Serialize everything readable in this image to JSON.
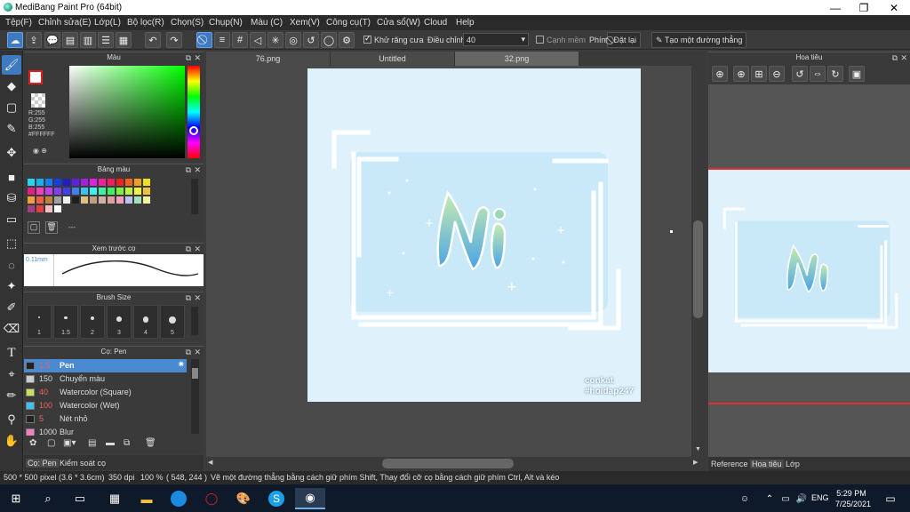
{
  "window": {
    "title": "MediBang Paint Pro (64bit)",
    "minimize": "—",
    "maximize": "❐",
    "close": "✕"
  },
  "menu": [
    "Tệp(F)",
    "Chỉnh sửa(E)",
    "Lớp(L)",
    "Bộ lọc(R)",
    "Chọn(S)",
    "Chụp(N)",
    "Màu (C)",
    "Xem(V)",
    "Công cụ(T)",
    "Cửa sổ(W)",
    "Cloud",
    "Help"
  ],
  "toolbar": {
    "antialias_label": "Khử răng cưa",
    "adjust_label": "Điều chỉnh",
    "adjust_value": "40",
    "edge_label": "Cạnh mềm",
    "key_label": "Phím",
    "reset_label": "Đặt lại",
    "create_line_label": "Tạo một đường thẳng"
  },
  "panels": {
    "color": {
      "title": "Màu",
      "r": "R:255",
      "g": "G:255",
      "b": "B:255",
      "hex": "#FFFFFF"
    },
    "palette": {
      "title": "Bảng màu",
      "more": "---",
      "colors": [
        "#2ad4f0",
        "#18b0f0",
        "#1080f0",
        "#1040e0",
        "#2020c0",
        "#6020e0",
        "#a020e0",
        "#e020e0",
        "#f020a0",
        "#f02060",
        "#f02020",
        "#f06020",
        "#f0a020",
        "#f0e020",
        "#e02080",
        "#f040c0",
        "#c040f0",
        "#8040f0",
        "#4040f0",
        "#4080f0",
        "#40c0f0",
        "#40f0f0",
        "#40f0a0",
        "#40f060",
        "#80f040",
        "#c0f040",
        "#f0f040",
        "#f0c040",
        "#f0a040",
        "#f06040",
        "#c08040",
        "#a0a0a0",
        "#f0f0f0",
        "#202020",
        "#e0c080",
        "#c0a080",
        "#d0b0a0",
        "#e0a0a0",
        "#f0a0c0",
        "#c0c0f0",
        "#a0e0c0",
        "#f0f0a0",
        "#a04080",
        "#e04040",
        "#f0c0c0",
        "#ffffff"
      ]
    },
    "preview": {
      "title": "Xem trước cọ",
      "size": "0.11mm"
    },
    "brush_size": {
      "title": "Brush Size",
      "sizes": [
        "1",
        "1.5",
        "2",
        "3",
        "4",
        "5"
      ]
    },
    "brush": {
      "title": "Cọ: Pen",
      "items": [
        {
          "size": "1.5",
          "name": "Pen",
          "color": "#222222"
        },
        {
          "size": "150",
          "name": "Chuyển màu",
          "color": "#cccccc"
        },
        {
          "size": "40",
          "name": "Watercolor (Square)",
          "color": "#c8e060"
        },
        {
          "size": "100",
          "name": "Watercolor (Wet)",
          "color": "#40c0f0"
        },
        {
          "size": "5",
          "name": "Nét nhỏ",
          "color": "#222222"
        },
        {
          "size": "1000",
          "name": "Blur",
          "color": "#f080c0"
        }
      ]
    },
    "bottom_tabs": [
      "Cọ: Pen",
      "Kiểm soát cọ"
    ]
  },
  "tabs": [
    "76.png",
    "Untitled",
    "32.png"
  ],
  "artwork": {
    "signature1": "conkat",
    "signature2": "#hoidap247",
    "signature2_sub": "247"
  },
  "navigator": {
    "title": "Hoa tiêu",
    "tabs": [
      "Reference",
      "Hoa tiêu",
      "Lớp"
    ]
  },
  "status": {
    "size": "500 * 500 pixel",
    "cm": "(3.6 * 3.6cm)",
    "dpi": "350 dpi",
    "zoom": "100 %",
    "coords": "( 548, 244 )",
    "hint": "Vẽ một đường thẳng bằng cách giữ phím Shift, Thay đổi cỡ cọ bằng cách giữ phím Ctrl, Alt và kéo"
  },
  "taskbar": {
    "lang": "ENG",
    "time": "5:29 PM",
    "date": "7/25/2021"
  },
  "colors": {
    "accent": "#3d7ac0",
    "canvas_bg": "#dff2fb",
    "frame": "#ffffff",
    "nav_bg": "#555555"
  }
}
